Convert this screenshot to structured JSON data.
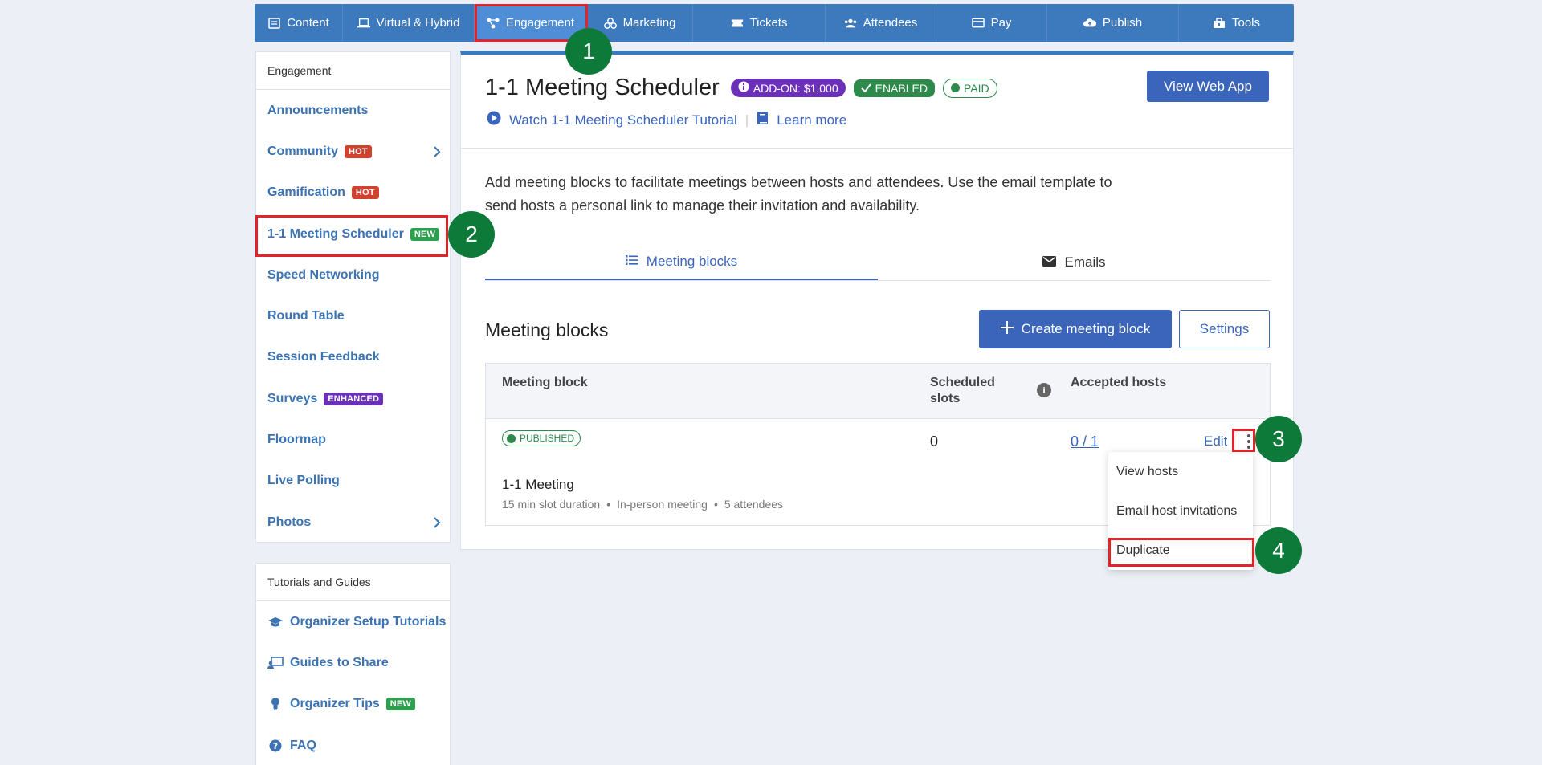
{
  "topnav": {
    "items": [
      {
        "label": "Content",
        "icon": "newspaper-icon"
      },
      {
        "label": "Virtual & Hybrid",
        "icon": "laptop-icon"
      },
      {
        "label": "Engagement",
        "icon": "network-icon"
      },
      {
        "label": "Marketing",
        "icon": "bullhorn-icon"
      },
      {
        "label": "Tickets",
        "icon": "ticket-icon"
      },
      {
        "label": "Attendees",
        "icon": "users-icon"
      },
      {
        "label": "Pay",
        "icon": "credit-card-icon"
      },
      {
        "label": "Publish",
        "icon": "cloud-upload-icon"
      },
      {
        "label": "Tools",
        "icon": "toolbox-icon"
      }
    ]
  },
  "sidebar": {
    "heading": "Engagement",
    "items": [
      {
        "label": "Announcements"
      },
      {
        "label": "Community",
        "badge": "HOT"
      },
      {
        "label": "Gamification",
        "badge": "HOT"
      },
      {
        "label": "1-1 Meeting Scheduler",
        "badge": "NEW"
      },
      {
        "label": "Speed Networking"
      },
      {
        "label": "Round Table"
      },
      {
        "label": "Session Feedback"
      },
      {
        "label": "Surveys",
        "badge": "ENHANCED"
      },
      {
        "label": "Floormap"
      },
      {
        "label": "Live Polling"
      },
      {
        "label": "Photos"
      }
    ]
  },
  "guides": {
    "heading": "Tutorials and Guides",
    "items": [
      {
        "label": "Organizer Setup Tutorials",
        "icon": "graduation-cap-icon"
      },
      {
        "label": "Guides to Share",
        "icon": "presentation-icon"
      },
      {
        "label": "Organizer Tips",
        "icon": "lightbulb-icon",
        "badge": "NEW"
      },
      {
        "label": "FAQ",
        "icon": "question-circle-icon"
      }
    ]
  },
  "main": {
    "title": "1-1 Meeting Scheduler",
    "addon_label": "ADD-ON: $1,000",
    "enabled_label": "ENABLED",
    "paid_label": "PAID",
    "view_web_app": "View Web App",
    "tutorial_link": "Watch 1-1 Meeting Scheduler Tutorial",
    "separator": "|",
    "learn_more": "Learn more",
    "description": "Add meeting blocks to facilitate meetings between hosts and attendees. Use the email template to send hosts a personal link to manage their invitation and availability.",
    "tabs": [
      {
        "label": "Meeting blocks"
      },
      {
        "label": "Emails"
      }
    ],
    "section_title": "Meeting blocks",
    "create_button": "Create meeting block",
    "settings_button": "Settings"
  },
  "table": {
    "headers": {
      "meeting_block": "Meeting block",
      "scheduled_line1": "Scheduled",
      "scheduled_line2": "slots",
      "accepted_hosts": "Accepted hosts"
    },
    "row": {
      "status": "PUBLISHED",
      "scheduled_slots": "0",
      "accepted_hosts": "0 / 1",
      "edit": "Edit",
      "name": "1-1 Meeting",
      "meta": [
        "15 min slot duration",
        "•",
        "In-person meeting",
        "•",
        "5 attendees"
      ]
    }
  },
  "dropdown": {
    "items": [
      {
        "label": "View hosts"
      },
      {
        "label": "Email host invitations"
      },
      {
        "label": "Duplicate"
      }
    ]
  },
  "steps": [
    "1",
    "2",
    "3",
    "4"
  ],
  "colors": {
    "nav_blue": "#3d79bd",
    "primary": "#3a65bb",
    "highlight_red": "#e2232a",
    "step_green": "#0d7a3a"
  }
}
